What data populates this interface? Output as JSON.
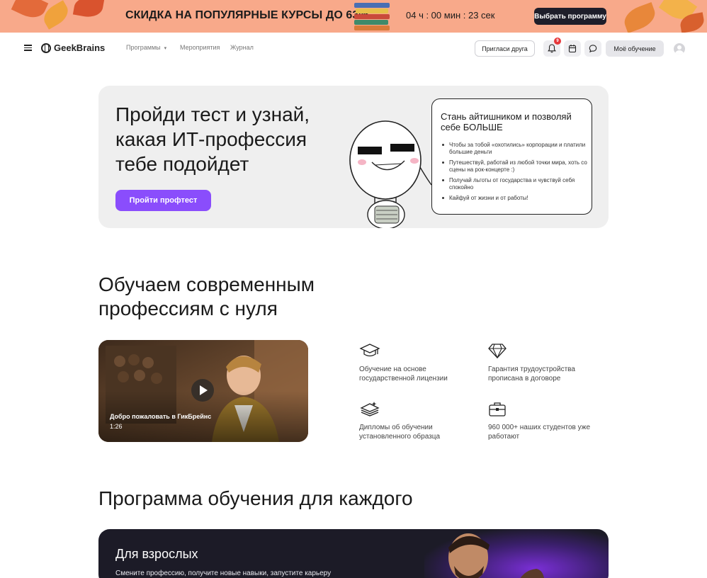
{
  "promo": {
    "text": "СКИДКА НА ПОПУЛЯРНЫЕ КУРСЫ ДО 63%",
    "timer": "04 ч : 00 мин : 23 сек",
    "button": "Выбрать программу",
    "background": "#f8a98a"
  },
  "header": {
    "logo": "GeekBrains",
    "nav": {
      "programs": "Программы",
      "events": "Мероприятия",
      "journal": "Журнал"
    },
    "invite_button": "Пригласи друга",
    "notification_count": "9",
    "my_learning_button": "Моё обучение"
  },
  "hero": {
    "title": "Пройди тест и узнай, какая ИТ-профессия тебе подойдет",
    "button": "Пройти профтест",
    "accent": "#8a4dfc",
    "bubble_title": "Стань айтишником и позволяй себе БОЛЬШЕ",
    "bubble_items": [
      "Чтобы за тобой «охотились» корпорации и платили большие деньги",
      "Путешествуй, работай из любой точки мира, хоть со сцены на рок-концерте :)",
      "Получай льготы от государства и чувствуй себя спокойно",
      "Кайфуй от жизни и от работы!"
    ]
  },
  "learning": {
    "title": "Обучаем современным профессиям с нуля",
    "video": {
      "title": "Добро пожаловать в ГикБрейнс",
      "duration": "1:26"
    },
    "features": [
      {
        "icon": "graduation-cap-icon",
        "text": "Обучение на основе государственной лицензии"
      },
      {
        "icon": "diamond-icon",
        "text": "Гарантия трудоустройства прописана в договоре"
      },
      {
        "icon": "diplomas-stack-icon",
        "text": "Дипломы об обучении установленного образца"
      },
      {
        "icon": "briefcase-icon",
        "text": "960 000+ наших студентов уже работают"
      }
    ]
  },
  "programs": {
    "title": "Программа обучения для каждого",
    "adult": {
      "title": "Для взрослых",
      "subtitle": "Смените профессию, получите новые навыки, запустите карьеру"
    }
  }
}
